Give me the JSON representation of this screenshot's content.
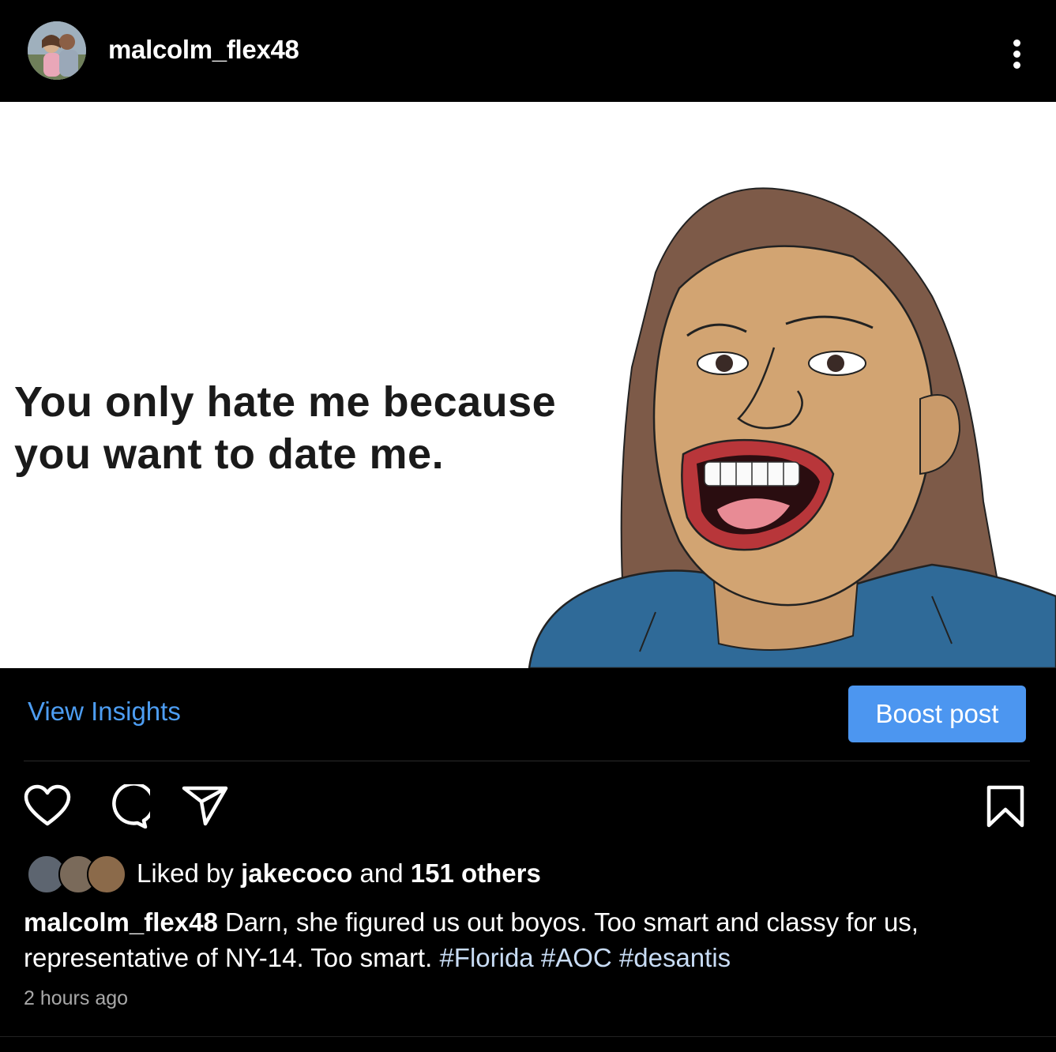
{
  "header": {
    "username": "malcolm_flex48",
    "more_icon": "more-vertical-icon"
  },
  "post": {
    "meme_text_line1": "You only hate me because",
    "meme_text_line2": "you want to date me."
  },
  "insights": {
    "view_insights": "View Insights",
    "boost_post": "Boost post"
  },
  "actions": {
    "like_icon": "heart-icon",
    "comment_icon": "comment-icon",
    "share_icon": "send-icon",
    "save_icon": "bookmark-icon"
  },
  "likes": {
    "prefix": "Liked by ",
    "user": "jakecoco",
    "middle": " and ",
    "others": "151 others"
  },
  "caption": {
    "username": "malcolm_flex48",
    "text": " Darn, she figured us out boyos. Too smart and classy for us, representative of NY-14. Too smart. ",
    "hashtags": [
      "#Florida",
      "#AOC",
      "#desantis"
    ]
  },
  "timestamp": "2 hours ago",
  "colors": {
    "link": "#4d9df2",
    "boost_button": "#4c96f0",
    "hashtag": "#c8dcf5",
    "background": "#000000"
  }
}
